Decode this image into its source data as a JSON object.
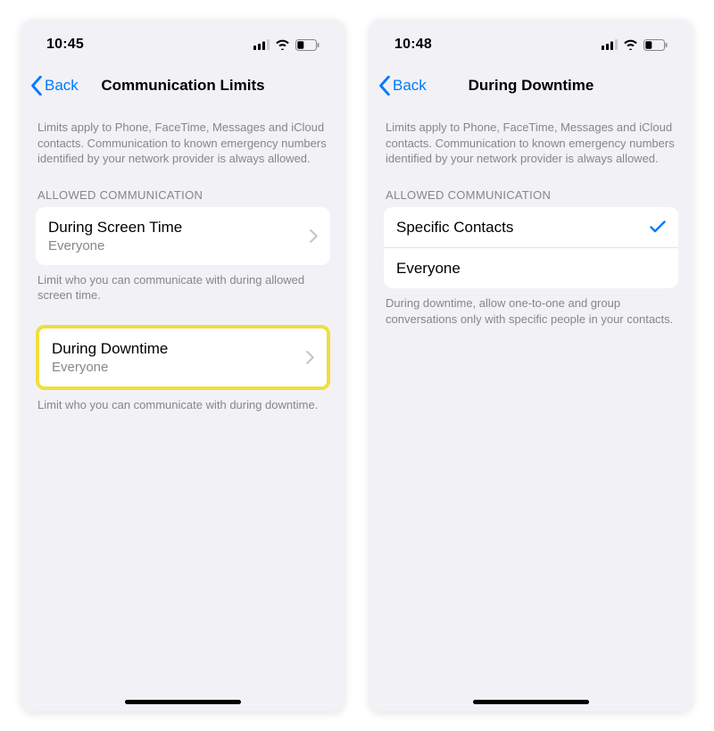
{
  "left": {
    "status_time": "10:45",
    "back_label": "Back",
    "title": "Communication Limits",
    "intro": "Limits apply to Phone, FaceTime, Messages and iCloud contacts. Communication to known emergency numbers identified by your network provider is always allowed.",
    "section_label": "ALLOWED COMMUNICATION",
    "row1": {
      "title": "During Screen Time",
      "subtitle": "Everyone"
    },
    "row1_footer": "Limit who you can communicate with during allowed screen time.",
    "row2": {
      "title": "During Downtime",
      "subtitle": "Everyone"
    },
    "row2_footer": "Limit who you can communicate with during downtime."
  },
  "right": {
    "status_time": "10:48",
    "back_label": "Back",
    "title": "During Downtime",
    "intro": "Limits apply to Phone, FaceTime, Messages and iCloud contacts. Communication to known emergency numbers identified by your network provider is always allowed.",
    "section_label": "ALLOWED COMMUNICATION",
    "opt1": "Specific Contacts",
    "opt2": "Everyone",
    "footer": "During downtime, allow one-to-one and group conversations only with specific people in your contacts."
  }
}
